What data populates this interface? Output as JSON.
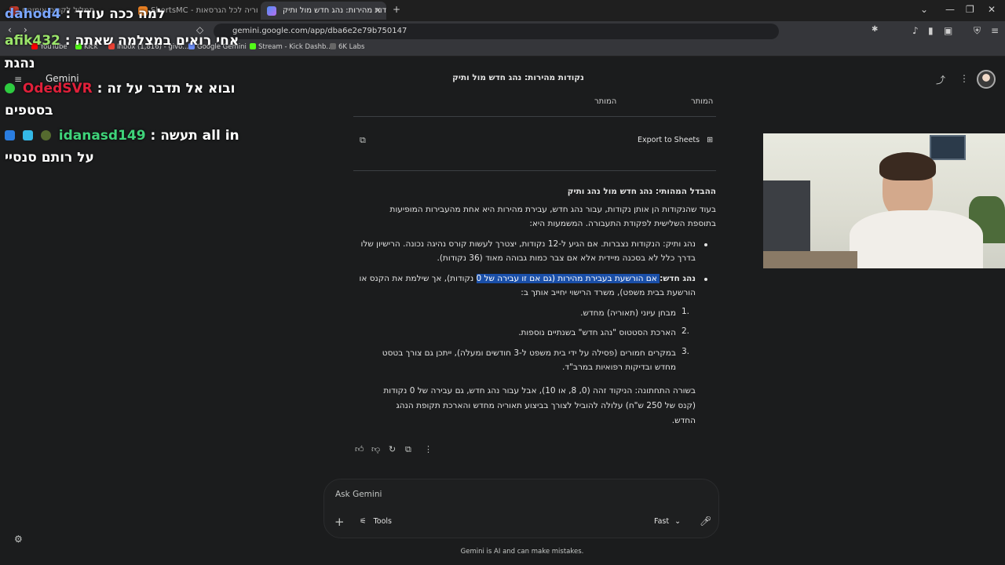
{
  "browser": {
    "tabs": [
      {
        "label": "תמליל לקורס אימונים"
      },
      {
        "label": "ShortsMC - תיאוריה לכל הגרסאות"
      },
      {
        "label": "נקודות מהירות: נהג חדש מול ותיק"
      }
    ],
    "url": "gemini.google.com/app/dba6e2e79b750147",
    "bookmarks": [
      "YouTube",
      "Kick",
      "Inbox (1,816) - givo...",
      "Google Gemini",
      "Stream - Kick Dashb...",
      "6K Labs"
    ]
  },
  "overlay_chat": [
    {
      "user": "dahod4",
      "sep": ":",
      "text": "למה ככה עודד",
      "color": "#7aa6ff"
    },
    {
      "user": "afik432",
      "sep": ":",
      "text": "אחי רואים במצלמה שאתה",
      "color": "#9be56a"
    },
    {
      "user": "",
      "sep": "",
      "text": "נהגת",
      "color": "#ffffff"
    },
    {
      "user": "OdedSVR",
      "sep": ":",
      "text": "ובוא אל תדבר על זה",
      "color": "#e0203a"
    },
    {
      "user": "",
      "sep": "",
      "text": "בסטפים",
      "color": "#ffffff"
    },
    {
      "user": "idanasd149",
      "sep": ":",
      "text": "תעשה all in",
      "color": "#3fd37a"
    },
    {
      "user": "",
      "sep": "",
      "text": "על רותם סנסיי",
      "color": "#ffffff"
    }
  ],
  "gemini": {
    "brand": "Gemini",
    "conversation_title": "נקודות מהירות: נהג חדש מול ותיק",
    "table_headers": [
      "המותר",
      "המותר"
    ],
    "export_label": "Export to Sheets",
    "heading": "ההבדל המהותי: נהג חדש מול נהג ותיק",
    "intro_1": "בעוד שהנקודות הן אותן נקודות, עבור נהג חדש, עבירת מהירות היא אחת מהעבירות המופיעות",
    "intro_2": "בתוספת השלישית לפקודת התעבורה. המשמעות היא:",
    "veteran_1": "נהג ותיק: הנקודות נצברות. אם הגיע ל-12 נקודות, יצטרך לעשות קורס נהיגה נכונה. הרישיון שלו",
    "veteran_2": "בדרך כלל לא בסכנה מיידית אלא אם צבר כמות גבוהה מאוד (36 נקודות).",
    "new_label": "נהג חדש:",
    "new_highlight": " אם הורשעת בעבירת מהירות (גם אם זו עבירה של 0",
    "new_rest": " נקודות), אך שילמת את הקנס או",
    "new_2": "הורשעת בבית משפט), משרד הרישוי יחייב אותך ב:",
    "list": [
      {
        "n": "1.",
        "text": "מבחן עיוני (תאוריה) מחדש."
      },
      {
        "n": "2.",
        "text": "הארכת הסטטוס \"נהג חדש\" בשנתיים נוספות."
      },
      {
        "n": "3.",
        "text": "במקרים חמורים (פסילה על ידי בית משפט ל-3 חודשים ומעלה), ייתכן גם צורך בטסט"
      },
      {
        "n": "",
        "text": "מחדש ובדיקות רפואיות במרב\"ד."
      }
    ],
    "bottom_1": "בשורה התחתונה: הניקוד זהה (0, 8, או 10), אבל עבור נהג חדש, גם עבירה של 0 נקודות",
    "bottom_2": "(קנס של 250 ש\"ח) עלולה להוביל לצורך בביצוע תאוריה מחדש והארכת תקופת הנהג",
    "bottom_3": "החדש.",
    "input_placeholder": "Ask Gemini",
    "tools_label": "Tools",
    "mode_label": "Fast",
    "footer": "Gemini is AI and can make mistakes."
  }
}
